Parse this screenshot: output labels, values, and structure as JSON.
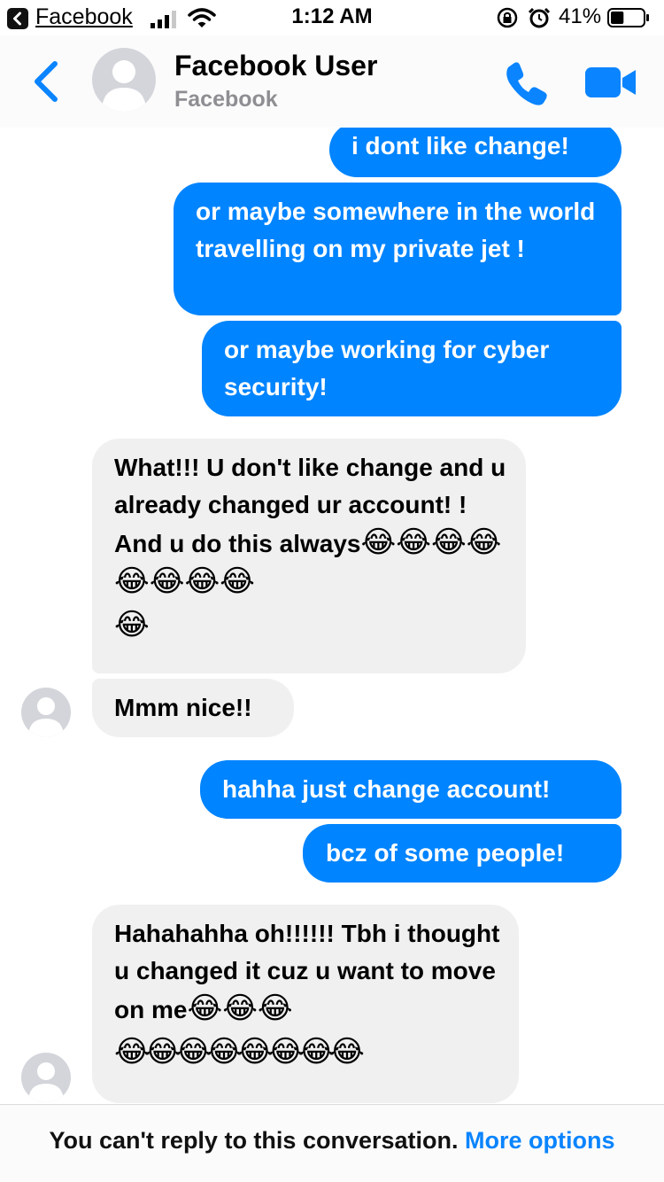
{
  "status_bar": {
    "back_app": "Facebook",
    "time": "1:12 AM",
    "battery_percent": "41%",
    "battery_level": 0.41
  },
  "header": {
    "name": "Facebook User",
    "subtitle": "Facebook",
    "icons": [
      "back-chevron-icon",
      "avatar",
      "phone-icon",
      "video-camera-icon"
    ]
  },
  "messages": [
    {
      "direction": "out",
      "text": "i dont like change!"
    },
    {
      "direction": "out",
      "text": "or maybe somewhere in the world travelling on my private jet !"
    },
    {
      "direction": "out",
      "text": "or maybe working for cyber security!"
    },
    {
      "direction": "in",
      "text": "What!!! U don't like change and u already changed ur account! ! And u do this always",
      "emoji_line1": "😂😂😂😂😂😂😂😂",
      "emoji_line2": "😂"
    },
    {
      "direction": "in",
      "text": "Mmm nice!!"
    },
    {
      "direction": "out",
      "text": "hahha just change account!"
    },
    {
      "direction": "out",
      "text": "bcz of some people!"
    },
    {
      "direction": "in",
      "text": "Hahahahha oh!!!!!! Tbh i thought u changed it cuz u want to move on me",
      "emoji_line1": "😂😂😂",
      "emoji_line2": "😂😂😂😂😂😂😂😂"
    }
  ],
  "footer": {
    "text": "You can't reply to this conversation.",
    "link": "More options"
  },
  "colors": {
    "outgoing_bubble": "#0084ff",
    "incoming_bubble": "#f0f0f0",
    "accent": "#0a84ff"
  }
}
